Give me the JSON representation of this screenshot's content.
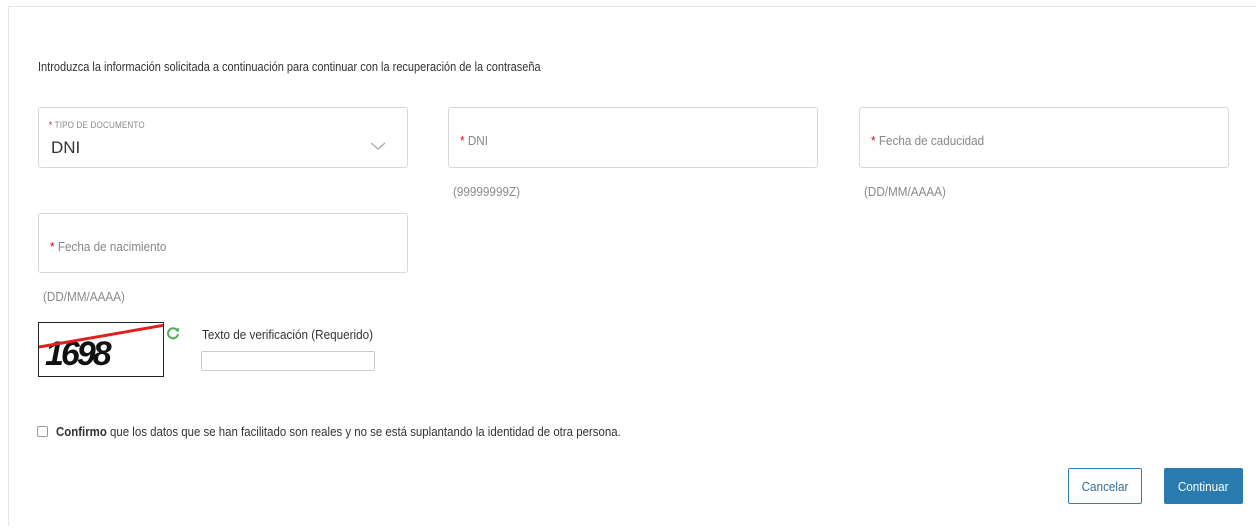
{
  "intro_text": "Introduzca la información solicitada a continuación para continuar con la recuperación de la contraseña",
  "document_type": {
    "label": "TIPO DE DOCUMENTO",
    "required_mark": "*",
    "value": "DNI"
  },
  "dni": {
    "required_mark": "*",
    "placeholder": "DNI",
    "hint": "(99999999Z)"
  },
  "expiry_date": {
    "required_mark": "*",
    "placeholder": "Fecha de caducidad",
    "hint": "(DD/MM/AAAA)"
  },
  "birth_date": {
    "required_mark": "*",
    "placeholder": "Fecha de nacimiento",
    "hint": "(DD/MM/AAAA)"
  },
  "captcha": {
    "image_text": "1698",
    "verification_label": "Texto de verificación (Requerido)",
    "verification_value": ""
  },
  "confirmation": {
    "bold_text": "Confirmo",
    "text": " que los datos que se han facilitado son reales y no se está suplantando la identidad de otra persona.",
    "checked": false
  },
  "buttons": {
    "cancel": "Cancelar",
    "continue": "Continuar"
  },
  "colors": {
    "primary": "#2a7bb0",
    "required": "#d0021b",
    "refresh_icon": "#4caf50",
    "captcha_strike": "#e02020"
  }
}
